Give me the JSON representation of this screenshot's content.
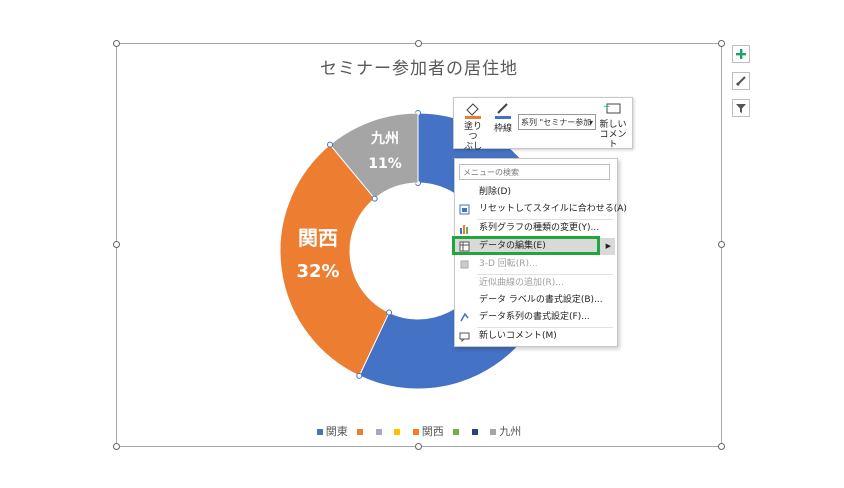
{
  "chart": {
    "title": "セミナー参加者の居住地",
    "labels": [
      {
        "category": "九州",
        "percent": "11%"
      },
      {
        "category": "関西",
        "percent": "32%"
      }
    ],
    "legend": [
      "関東",
      "",
      "",
      "",
      "関西",
      "",
      "",
      "九州"
    ]
  },
  "colors": {
    "kanto": "#4472c4",
    "kansai": "#ed7d31",
    "kyushu": "#a5a5a5",
    "gray_legend": "#a5a5a5",
    "yellow": "#ffc000",
    "green": "#70ad47",
    "navy": "#264478",
    "blue2": "#5b9bd5",
    "highlight_border": "#21a63b"
  },
  "side_buttons": [
    "plus-icon",
    "brush-icon",
    "filter-icon"
  ],
  "mini_toolbar": {
    "fill_label_1": "塗りつ",
    "fill_label_2": "ぶし",
    "outline_label": "枠線",
    "series_value": "系列 \"セミナー参加",
    "new_comment_1": "新しい",
    "new_comment_2": "コメント"
  },
  "context_menu": {
    "search_placeholder": "メニューの検索",
    "items": [
      {
        "label": "削除(D)",
        "enabled": true
      },
      {
        "label": "リセットしてスタイルに合わせる(A)",
        "enabled": true
      },
      {
        "label": "系列グラフの種類の変更(Y)...",
        "enabled": true
      },
      {
        "label": "データの編集(E)",
        "enabled": true
      },
      {
        "label": "3-D 回転(R)...",
        "enabled": false
      },
      {
        "label": "近似曲線の追加(R)...",
        "enabled": false
      },
      {
        "label": "データ ラベルの書式設定(B)...",
        "enabled": true
      },
      {
        "label": "データ系列の書式設定(F)...",
        "enabled": true
      },
      {
        "label": "新しいコメント(M)",
        "enabled": true
      }
    ]
  },
  "chart_data": {
    "type": "pie",
    "title": "セミナー参加者の居住地",
    "categories": [
      "関東",
      "関西",
      "九州"
    ],
    "values": [
      57,
      32,
      11
    ],
    "visible_data_labels": [
      "九州 11%",
      "関西 32%"
    ],
    "legend_position": "bottom"
  }
}
